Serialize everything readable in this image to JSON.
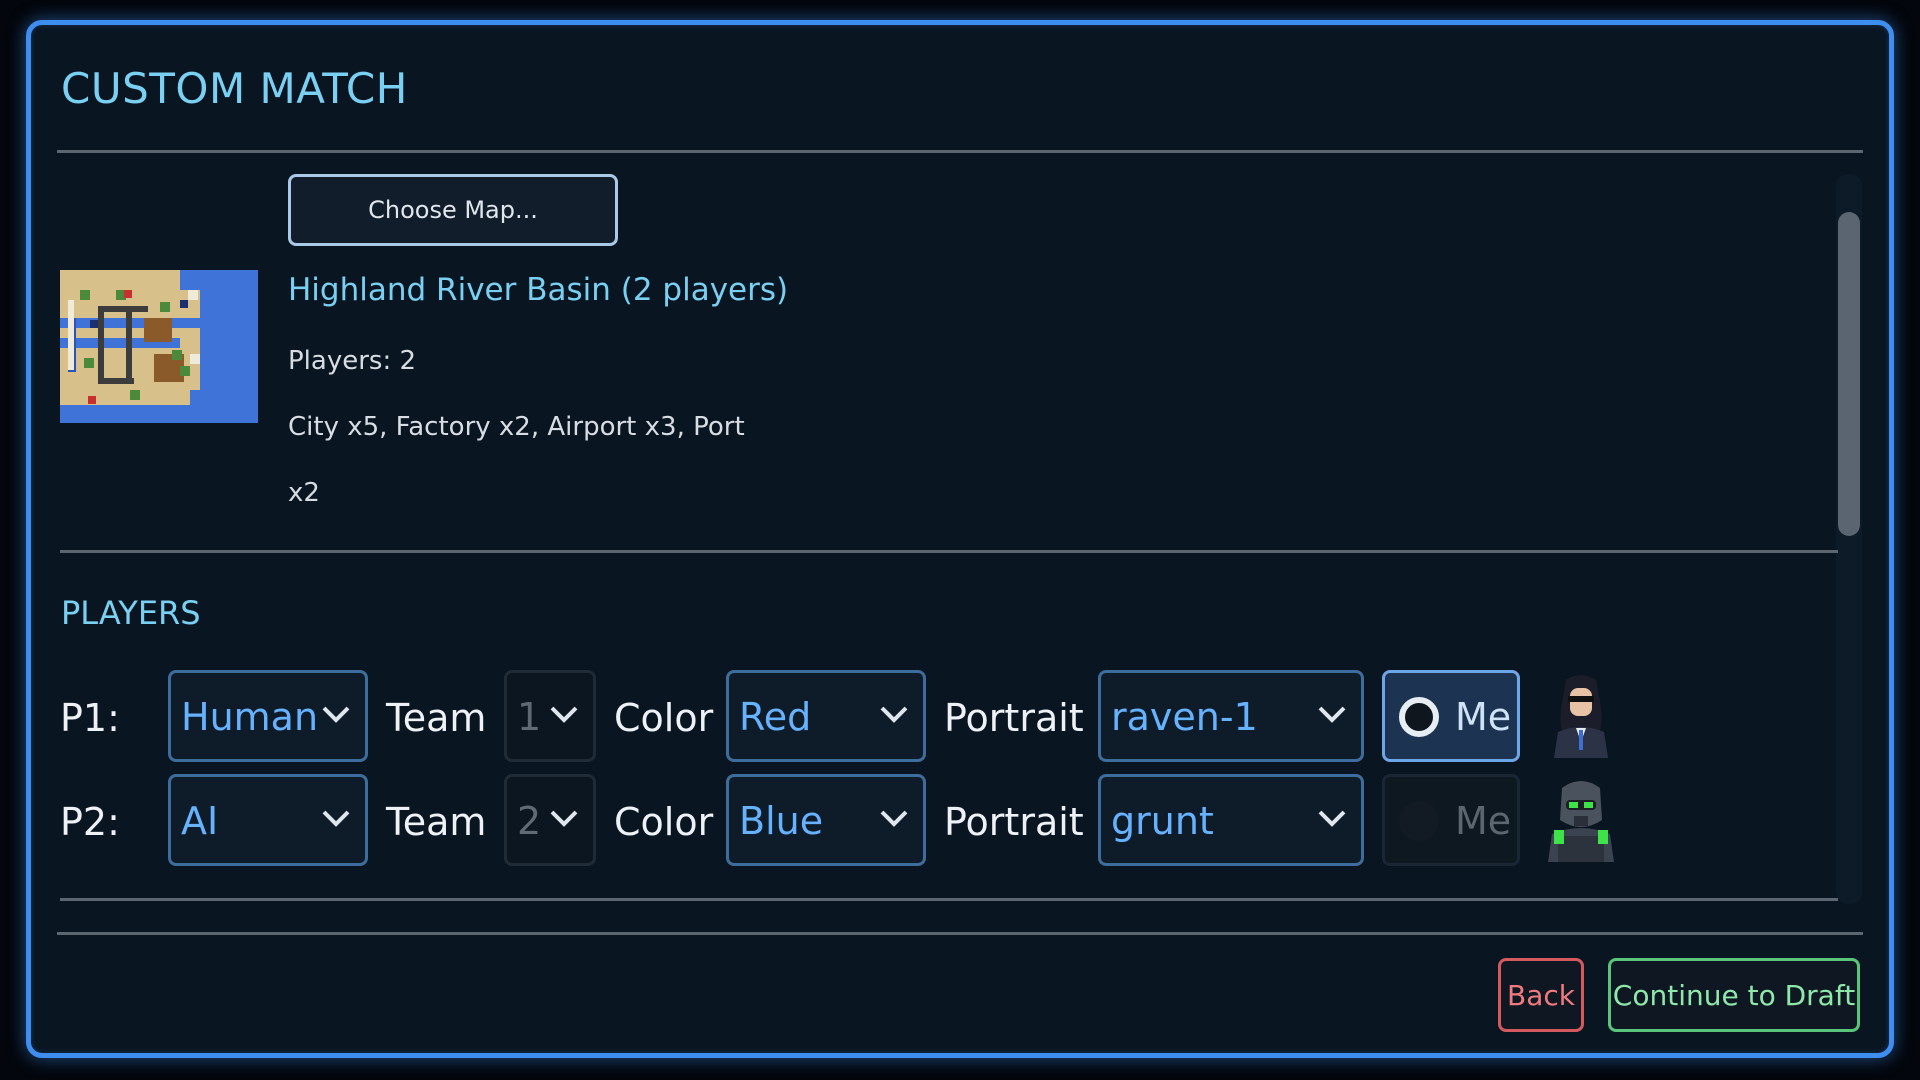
{
  "window": {
    "title": "CUSTOM MATCH"
  },
  "map": {
    "choose_button": "Choose Map...",
    "name": "Highland River Basin  (2 players)",
    "players_line": "Players: 2",
    "buildings_line1": "City x5, Factory x2, Airport x3, Port",
    "buildings_line2": "x2"
  },
  "players_section": {
    "heading": "PLAYERS",
    "labels": {
      "team": "Team",
      "color": "Color",
      "portrait": "Portrait",
      "me": "Me"
    },
    "rows": [
      {
        "id": "P1:",
        "type": "Human",
        "team": "1",
        "color": "Red",
        "portrait": "raven-1",
        "me_selected": true,
        "portrait_icon": "raven-portrait-icon"
      },
      {
        "id": "P2:",
        "type": "AI",
        "team": "2",
        "color": "Blue",
        "portrait": "grunt",
        "me_selected": false,
        "portrait_icon": "grunt-portrait-icon"
      }
    ]
  },
  "footer": {
    "back": "Back",
    "continue": "Continue to Draft"
  },
  "colors": {
    "frame_border": "#3d8ef0",
    "accent_title": "#79d0f2",
    "select_value": "#67b2ff",
    "back_border": "#d55a60",
    "continue_border": "#58c57a"
  }
}
